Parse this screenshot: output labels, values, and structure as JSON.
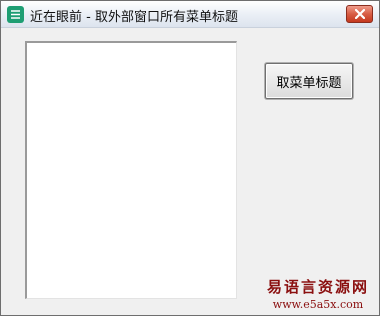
{
  "window": {
    "title": "近在眼前 - 取外部窗口所有菜单标题",
    "app_icon": "app-logo-icon",
    "close_icon": "close-icon"
  },
  "main": {
    "button_label": "取菜单标题",
    "list_items": []
  },
  "watermark": {
    "cn": "易语言资源网",
    "url": "www.e5a5x.com"
  },
  "colors": {
    "close_button": "#d75d45",
    "app_icon": "#1e9e73",
    "watermark": "#8b1010"
  }
}
